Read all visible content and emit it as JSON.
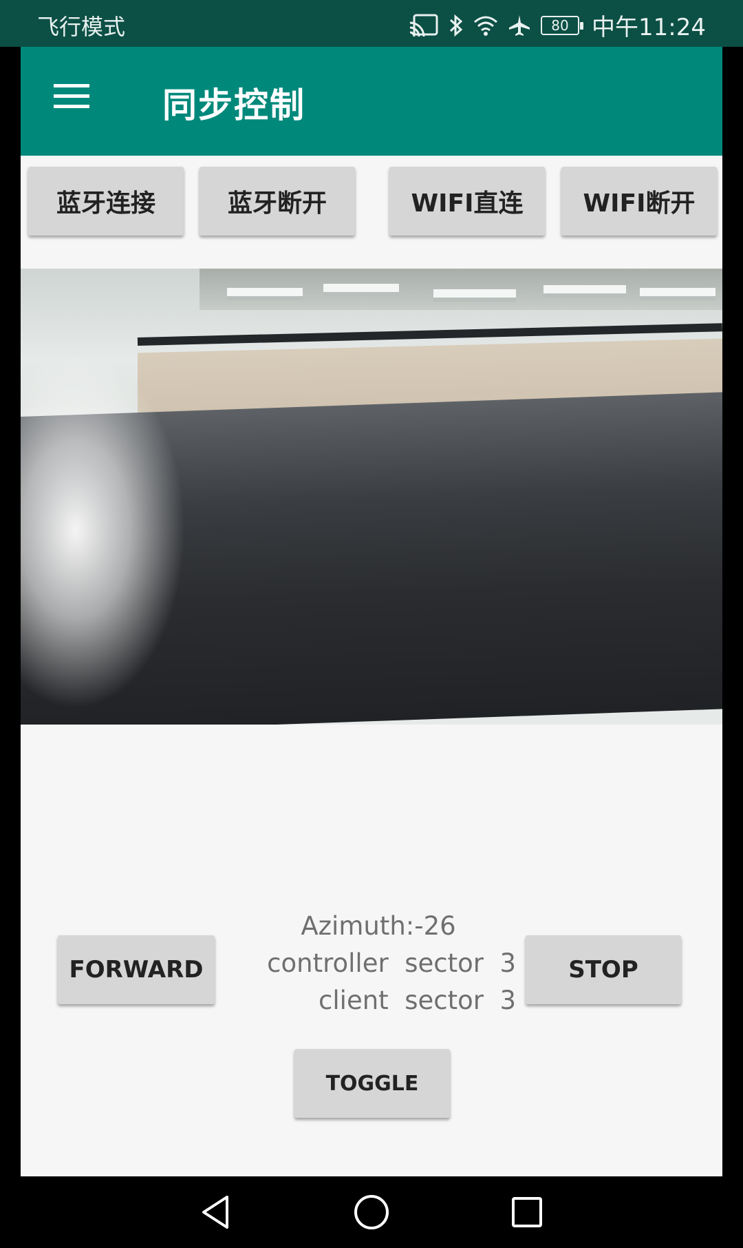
{
  "status_bar": {
    "mode_label": "飞行模式",
    "battery": "80",
    "time": "中午11:24",
    "icons": [
      "cast-icon",
      "bluetooth-icon",
      "wifi-icon",
      "airplane-icon",
      "battery-icon"
    ]
  },
  "toolbar": {
    "title": "同步控制",
    "menu_icon": "hamburger-menu-icon",
    "color": "#00897b"
  },
  "top_buttons": {
    "bt_connect": "蓝牙连接",
    "bt_disconnect": "蓝牙断开",
    "wifi_direct": "WIFI直连",
    "wifi_disconnect": "WIFI断开"
  },
  "readout": {
    "azimuth": "Azimuth:-26",
    "controller": "controller  sector  3",
    "client": "client  sector  3"
  },
  "controls": {
    "forward": "FORWARD",
    "stop": "STOP",
    "toggle": "TOGGLE"
  },
  "nav_bar": {
    "icons": [
      "back-triangle-icon",
      "home-circle-icon",
      "recents-square-icon"
    ]
  }
}
